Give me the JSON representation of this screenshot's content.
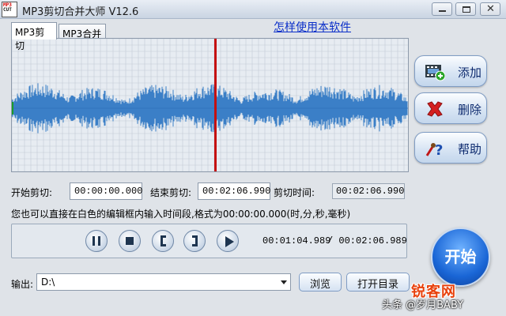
{
  "window": {
    "title": "MP3剪切合并大师 V12.6",
    "icon_lines": [
      "MP3",
      "CUT"
    ],
    "minimize_icon": "minimize-icon",
    "maximize_icon": "maximize-icon",
    "close_icon": "close-icon",
    "close_glyph": "✕"
  },
  "tabs": [
    {
      "label": "MP3剪切",
      "active": true
    },
    {
      "label": "MP3合并",
      "active": false
    }
  ],
  "help_link": "怎样使用本软件",
  "waveform": {
    "background": "#e7ecf2",
    "grid_color": "#c4ccd6",
    "wave_color": "#3b7fc7",
    "playhead_color": "#c41010",
    "playhead_position": 0.5
  },
  "side_buttons": {
    "add": {
      "label": "添加",
      "icon": "add-clip-icon"
    },
    "delete": {
      "label": "删除",
      "icon": "delete-x-icon"
    },
    "help": {
      "label": "帮助",
      "icon": "help-question-icon"
    }
  },
  "cut_times": {
    "start_label": "开始剪切:",
    "start_value": "00:00:00.000",
    "end_label": "结束剪切:",
    "end_value": "00:02:06.990",
    "duration_label": "剪切时间:",
    "duration_value": "00:02:06.990"
  },
  "hint": "您也可以直接在白色的编辑框内输入时间段,格式为00:00:00.000(时,分,秒,毫秒)",
  "player": {
    "controls": [
      "pause-icon",
      "stop-icon",
      "mark-start-icon",
      "mark-end-icon",
      "play-selection-icon"
    ],
    "current_time": "00:01:04.989",
    "total_time": "/ 00:02:06.989"
  },
  "start_button": "开始",
  "output": {
    "label": "输出:",
    "path": "D:\\",
    "browse": "浏览",
    "open_dir": "打开目录"
  },
  "watermark": {
    "logo": "锐客网",
    "text": "头条 @岁月BABY"
  }
}
